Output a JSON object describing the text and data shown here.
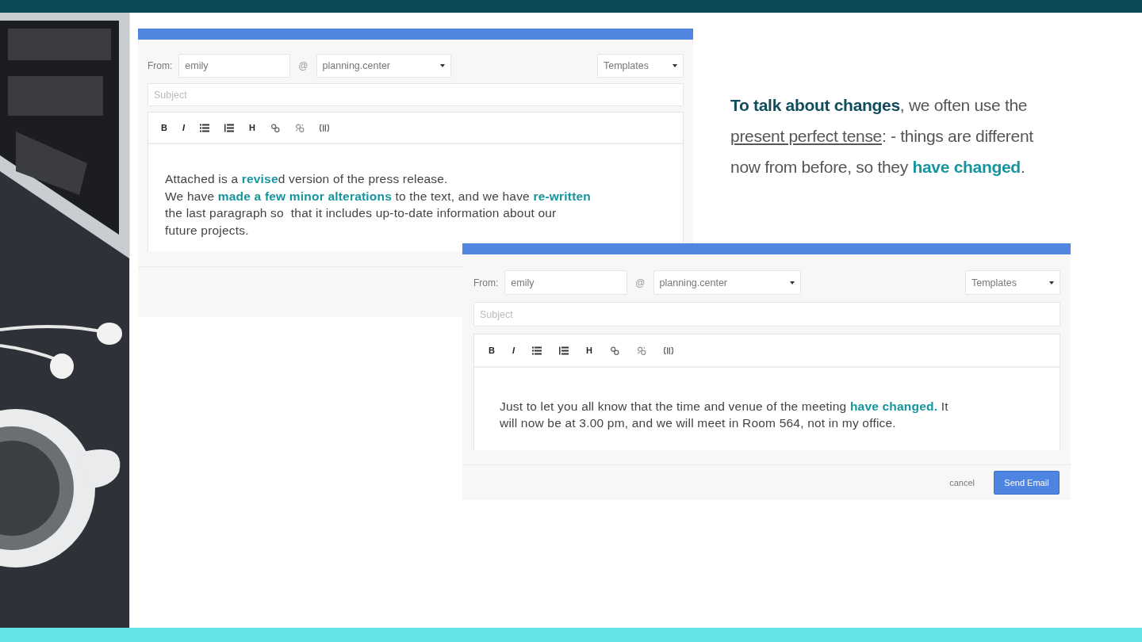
{
  "composers": [
    {
      "from_label": "From:",
      "user": "emily",
      "at": "@",
      "domain": "planning.center",
      "templates": "Templates",
      "subject_placeholder": "Subject",
      "toolbar": [
        {
          "kind": "bold",
          "label": "B"
        },
        {
          "kind": "italic",
          "label": "I"
        },
        {
          "kind": "bullet-list"
        },
        {
          "kind": "numbered-list"
        },
        {
          "kind": "heading",
          "label": "H"
        },
        {
          "kind": "link"
        },
        {
          "kind": "unlink"
        },
        {
          "kind": "code"
        }
      ],
      "body": [
        "Attached is a **revise**d version of the press release.",
        "We have **made a few minor alterations** to the text, and we have **re-written**",
        "the last paragraph so  that it includes up-to-date information about our",
        "future projects."
      ]
    },
    {
      "from_label": "From:",
      "user": "emily",
      "at": "@",
      "domain": "planning.center",
      "templates": "Templates",
      "subject_placeholder": "Subject",
      "toolbar": [
        {
          "kind": "bold",
          "label": "B"
        },
        {
          "kind": "italic",
          "label": "I"
        },
        {
          "kind": "bullet-list"
        },
        {
          "kind": "numbered-list"
        },
        {
          "kind": "heading",
          "label": "H"
        },
        {
          "kind": "link"
        },
        {
          "kind": "unlink"
        },
        {
          "kind": "code"
        }
      ],
      "body": [
        "Just to let you all know that the time and venue of the meeting **have changed.** It",
        "will now be at 3.00 pm, and we will meet in Room 564, not in my office."
      ],
      "actions": [
        {
          "kind": "link",
          "label": "cancel"
        },
        {
          "kind": "primary",
          "label": "Send Email"
        }
      ]
    }
  ],
  "explanation": [
    {
      "kind": "lead",
      "text": "To talk about changes"
    },
    {
      "kind": "plain",
      "text": ", we often use the "
    },
    {
      "kind": "term",
      "text": "present perfect tense"
    },
    {
      "kind": "plain",
      "text": ": - things are different now from before, so they "
    },
    {
      "kind": "highlight",
      "text": "have changed"
    },
    {
      "kind": "plain",
      "text": "."
    }
  ]
}
